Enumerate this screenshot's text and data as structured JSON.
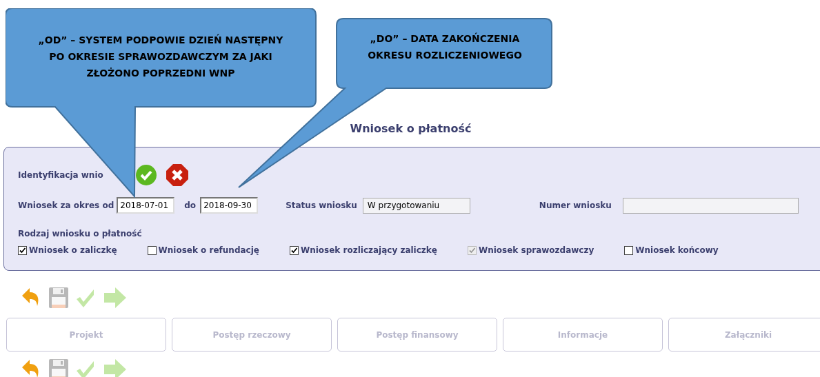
{
  "callouts": [
    {
      "text": "„OD” – SYSTEM PODPOWIE DZIEŃ NASTĘPNY PO OKRESIE SPRAWOZDAWCZYM ZA JAKI ZŁOŻONO POPRZEDNI WNP"
    },
    {
      "text": "„DO” – DATA ZAKOŃCZENIA OKRESU ROZLICZENIOWEGO"
    }
  ],
  "page_title": "Wniosek o płatność",
  "panel": {
    "heading": "Identyfikacja wnio",
    "period_label": "Wniosek za okres od",
    "from_value": "2018-07-01",
    "to_label": "do",
    "to_value": "2018-09-30",
    "status_label": "Status wniosku",
    "status_value": "W przygotowaniu",
    "number_label": "Numer wniosku",
    "type_label": "Rodzaj wniosku o płatność",
    "types": [
      {
        "label": "Wniosek o zaliczkę",
        "checked": true,
        "disabled": false
      },
      {
        "label": "Wniosek o refundację",
        "checked": false,
        "disabled": false
      },
      {
        "label": "Wniosek rozliczający zaliczkę",
        "checked": true,
        "disabled": false
      },
      {
        "label": "Wniosek sprawozdawczy",
        "checked": true,
        "disabled": true
      },
      {
        "label": "Wniosek końcowy",
        "checked": false,
        "disabled": false
      }
    ]
  },
  "toolbar": [
    {
      "kind": "undo",
      "disabled": false
    },
    {
      "kind": "save",
      "disabled": true
    },
    {
      "kind": "check",
      "disabled": true
    },
    {
      "kind": "next",
      "disabled": true
    }
  ],
  "tabs": [
    {
      "label": "Projekt",
      "disabled": true
    },
    {
      "label": "Postęp rzeczowy",
      "disabled": true
    },
    {
      "label": "Postęp finansowy",
      "disabled": true
    },
    {
      "label": "Informacje",
      "disabled": true
    },
    {
      "label": "Załączniki",
      "disabled": true
    }
  ]
}
